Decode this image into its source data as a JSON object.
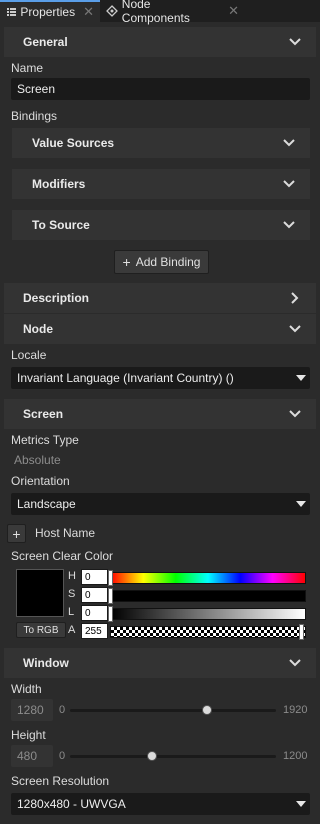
{
  "tabs": [
    {
      "label": "Properties"
    },
    {
      "label": "Node Components"
    }
  ],
  "general": {
    "title": "General",
    "name_label": "Name",
    "name_value": "Screen",
    "bindings_label": "Bindings",
    "value_sources": "Value Sources",
    "modifiers": "Modifiers",
    "to_source": "To Source",
    "add_binding": "Add Binding"
  },
  "description": {
    "title": "Description"
  },
  "node": {
    "title": "Node",
    "locale_label": "Locale",
    "locale_value": "Invariant Language (Invariant Country) ()"
  },
  "screen": {
    "title": "Screen",
    "metrics_label": "Metrics Type",
    "metrics_value": "Absolute",
    "orientation_label": "Orientation",
    "orientation_value": "Landscape",
    "host_name": "Host Name",
    "clear_color_label": "Screen Clear Color",
    "to_rgb": "To RGB",
    "hsla": [
      {
        "key": "H",
        "value": "0"
      },
      {
        "key": "S",
        "value": "0"
      },
      {
        "key": "L",
        "value": "0"
      },
      {
        "key": "A",
        "value": "255"
      }
    ]
  },
  "window": {
    "title": "Window",
    "width_label": "Width",
    "width_value": "1280",
    "width_min": "0",
    "width_max": "1920",
    "height_label": "Height",
    "height_value": "480",
    "height_min": "0",
    "height_max": "1200",
    "resolution_label": "Screen Resolution",
    "resolution_value": "1280x480 - UWVGA"
  },
  "colors": {
    "accent": "#5a9ee8",
    "panel": "#2b2b2b",
    "header": "#333333",
    "field": "#1a1a1a"
  }
}
